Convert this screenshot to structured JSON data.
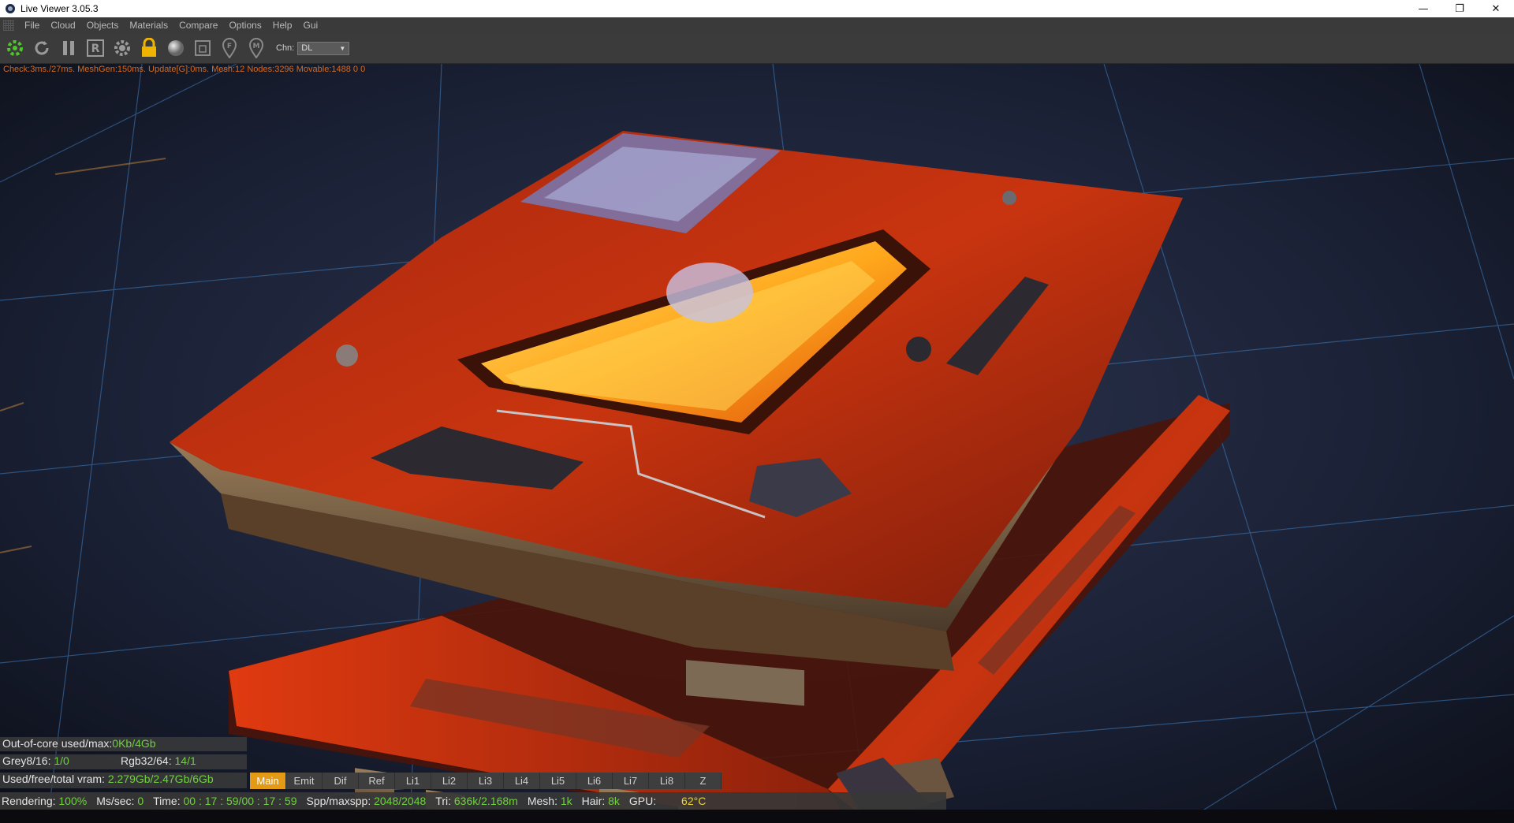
{
  "window": {
    "title": "Live Viewer 3.05.3"
  },
  "menu": [
    "File",
    "Cloud",
    "Objects",
    "Materials",
    "Compare",
    "Options",
    "Help",
    "Gui"
  ],
  "toolbar": {
    "chn_label": "Chn:",
    "chn_value": "DL"
  },
  "stats_line": "Check:3ms./27ms. MeshGen:150ms. Update[G]:0ms. Mesh:12 Nodes:3296 Movable:1488  0 0",
  "info": {
    "ooc_label": "Out-of-core used/max:",
    "ooc_value": "0Kb/4Gb",
    "grey_label": "Grey8/16:",
    "grey_value": "1/0",
    "rgb_label": "Rgb32/64:",
    "rgb_value": "14/1",
    "vram_label": "Used/free/total vram:",
    "vram_value": "2.279Gb/2.47Gb/6Gb"
  },
  "passes": [
    "Main",
    "Emit",
    "Dif",
    "Ref",
    "Li1",
    "Li2",
    "Li3",
    "Li4",
    "Li5",
    "Li6",
    "Li7",
    "Li8",
    "Z"
  ],
  "active_pass": "Main",
  "status": {
    "rendering_label": "Rendering:",
    "rendering_value": "100%",
    "mssec_label": "Ms/sec:",
    "mssec_value": "0",
    "time_label": "Time:",
    "time_value": "00 : 17 : 59/00 : 17 : 59",
    "spp_label": "Spp/maxspp:",
    "spp_value": "2048/2048",
    "tri_label": "Tri:",
    "tri_value": "636k/2.168m",
    "mesh_label": "Mesh:",
    "mesh_value": "1k",
    "hair_label": "Hair:",
    "hair_value": "8k",
    "gpu_label": "GPU:",
    "gpu_value": "62°C"
  },
  "colors": {
    "accent": "#e39a15",
    "value_green": "#6fd13e",
    "stats_orange": "#d56a1e",
    "case_red": "#c8300e",
    "lava": "#ffb020"
  }
}
